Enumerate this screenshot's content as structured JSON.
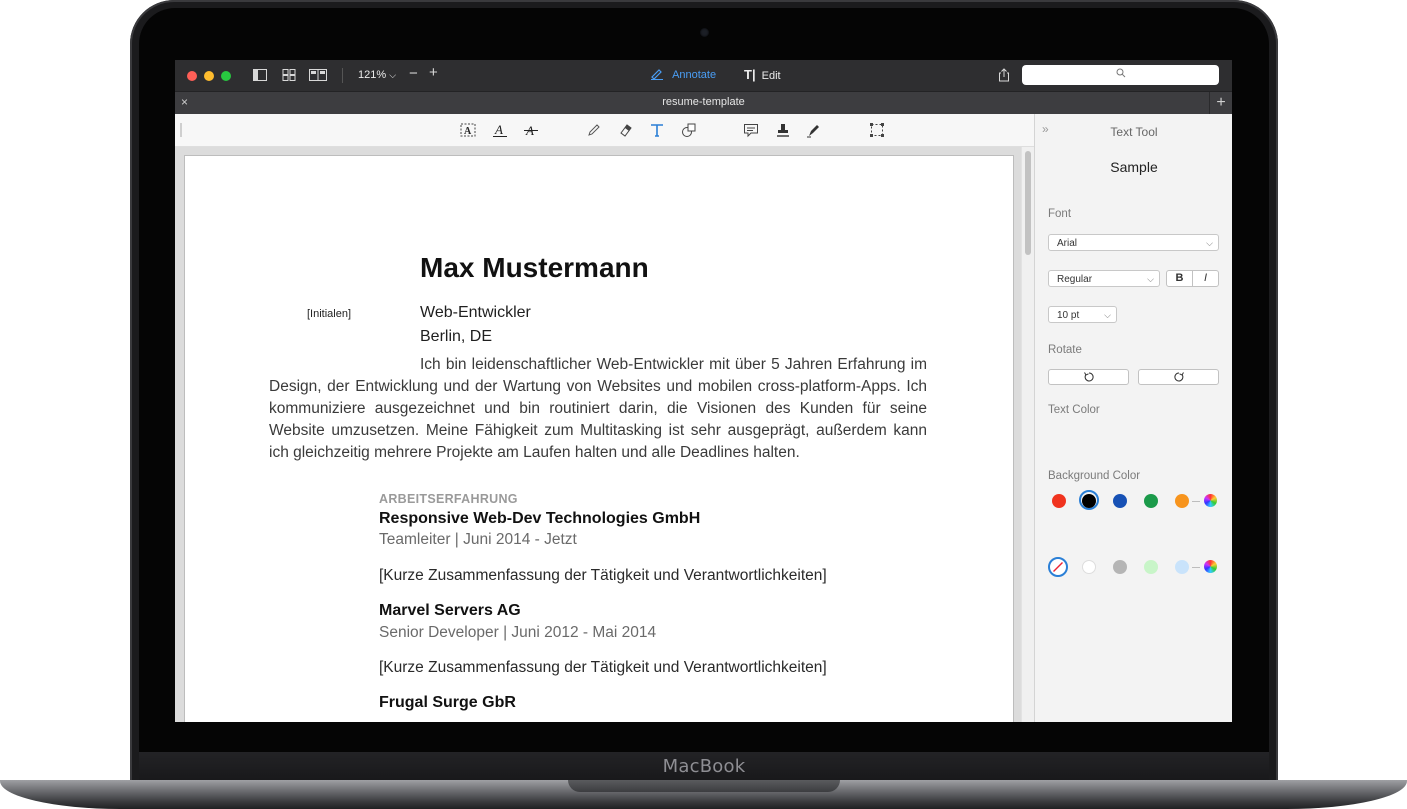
{
  "device": {
    "brand_label": "MacBook"
  },
  "titlebar": {
    "zoom_level": "121%",
    "annotate_label": "Annotate",
    "edit_label": "Edit"
  },
  "tab": {
    "document_name": "resume-template"
  },
  "toolbar": {
    "tools": [
      "text-box-icon",
      "text-underline-icon",
      "text-strikethrough-icon",
      "pencil-icon",
      "eraser-icon",
      "text-tool-icon",
      "shapes-icon",
      "comment-icon",
      "stamp-icon",
      "signature-pen-icon",
      "selection-icon"
    ],
    "active_tool": "text-tool-icon",
    "active_color": "#2a7fd6"
  },
  "document": {
    "name": "Max Mustermann",
    "initials_placeholder": "[Initialen]",
    "role": "Web-Entwickler",
    "city": "Berlin, DE",
    "summary": "Ich bin leidenschaftlicher Web-Entwickler mit über 5 Jahren Erfahrung im Design, der Entwicklung und der Wartung von Websites und mobilen  cross-platform-Apps. Ich kommuniziere ausgezeichnet und bin routiniert  darin, die Visionen des Kunden für seine Website umzusetzen. Meine Fähigkeit  zum  Multitasking  ist  sehr ausgeprägt, außerdem kann ich gleichzeitig mehrere Projekte am Laufen halten und alle Deadlines halten.",
    "section_heading": "ARBEITSERFAHRUNG",
    "jobs": [
      {
        "company": "Responsive Web-Dev Technologies GmbH",
        "meta": "Teamleiter | Juni 2014 - Jetzt",
        "description": "[Kurze Zusammenfassung der Tätigkeit und Verantwortlichkeiten]"
      },
      {
        "company": "Marvel Servers AG",
        "meta": "Senior Developer | Juni 2012 - Mai 2014",
        "description": "[Kurze Zusammenfassung der Tätigkeit und Verantwortlichkeiten]"
      },
      {
        "company": "Frugal Surge GbR"
      }
    ]
  },
  "sidebar": {
    "title": "Text Tool",
    "sample": "Sample",
    "font_label": "Font",
    "font_value": "Arial",
    "style_value": "Regular",
    "bold_label": "B",
    "italic_label": "I",
    "size_value": "10 pt",
    "rotate_label": "Rotate",
    "text_color_label": "Text Color",
    "text_colors": [
      "#f0331e",
      "#000000",
      "#1751b5",
      "#1b9a4a",
      "#f7941d"
    ],
    "selected_text_color": "#000000",
    "background_color_label": "Background Color",
    "background_colors": [
      "#ffffff",
      "#b5b5b5",
      "#c8f5c8",
      "#c9e3fb"
    ]
  }
}
